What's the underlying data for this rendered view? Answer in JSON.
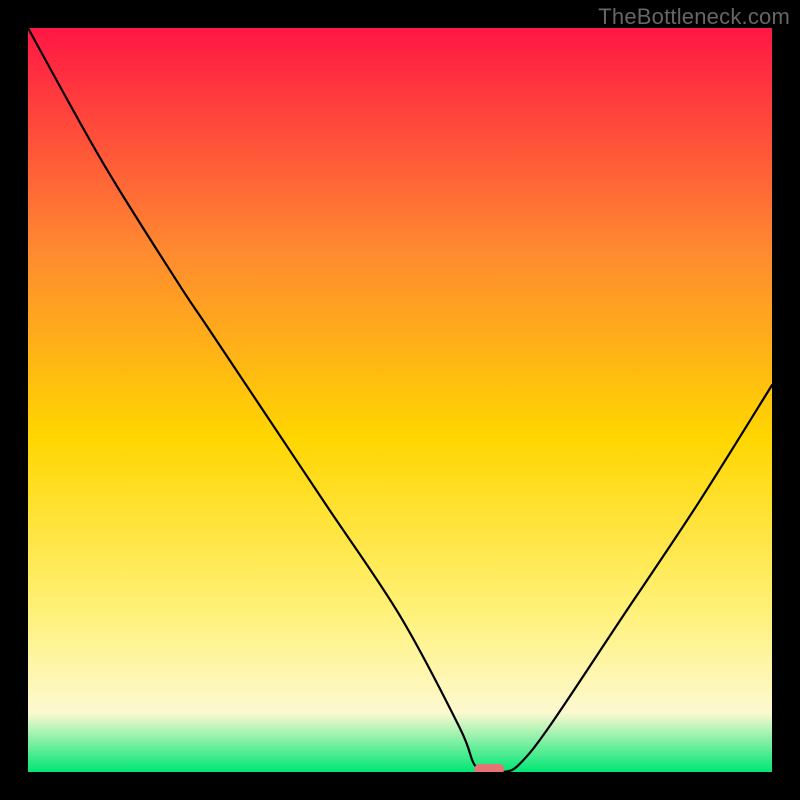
{
  "watermark": "TheBottleneck.com",
  "colors": {
    "frame": "#000000",
    "gradient_top": "#ff1744",
    "gradient_mid_upper": "#ff8a30",
    "gradient_mid": "#ffd600",
    "gradient_mid_lower": "#fff176",
    "gradient_lower": "#fdf9d0",
    "gradient_bottom": "#00e676",
    "curve": "#000000",
    "marker_fill": "#e57373",
    "marker_stroke": "#d24d4d"
  },
  "chart_data": {
    "type": "line",
    "title": "",
    "xlabel": "",
    "ylabel": "",
    "xlim": [
      0,
      100
    ],
    "ylim": [
      0,
      100
    ],
    "annotations": [
      {
        "name": "optimal-marker",
        "x": 62,
        "y": 0
      }
    ],
    "series": [
      {
        "name": "bottleneck-curve",
        "x": [
          0,
          10,
          20,
          24,
          30,
          40,
          50,
          58,
          60,
          62,
          64,
          66,
          70,
          80,
          90,
          100
        ],
        "y": [
          100,
          82,
          66,
          60,
          51,
          36,
          21,
          6,
          1,
          0,
          0,
          1,
          6,
          21,
          36,
          52
        ]
      }
    ]
  }
}
